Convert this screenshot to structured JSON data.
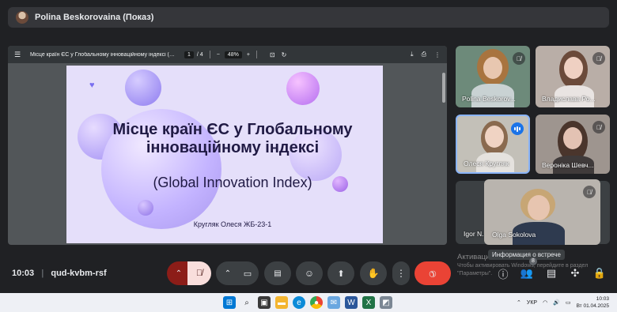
{
  "presenter": {
    "name": "Polina Beskorovaina (Показ)"
  },
  "pdf": {
    "title": "Місце країн ЄС у Глобальному інноваційному індексі (Global I...",
    "page_current": "1",
    "page_total": "/ 4",
    "zoom": "48%",
    "zoom_minus": "−",
    "zoom_plus": "+",
    "slide": {
      "title": "Місце країн ЄС у Глобальному інноваційному індексі",
      "subtitle": "(Global Innovation Index)",
      "author": "Кругляк Олеся ЖБ-23-1"
    }
  },
  "participants": [
    {
      "name": "Polina Beskorov...",
      "muted": true
    },
    {
      "name": "Владислава Ро...",
      "muted": true
    },
    {
      "name": "Олеся Кругляк",
      "speaking": true
    },
    {
      "name": "Вероніка Шевч...",
      "muted": true
    },
    {
      "name": "Igor N...",
      "muted": false
    },
    {
      "name": "Olga Sokolova",
      "muted": true
    }
  ],
  "meeting": {
    "time": "10:03",
    "separator": "|",
    "code": "qud-kvbm-rsf"
  },
  "tooltip": "Информация о встрече",
  "people_count": "8",
  "windows_activation": {
    "title": "Активация Windows",
    "text": "Чтобы активировать Windows, перейдите в раздел \"Параметры\"."
  },
  "taskbar": {
    "language": "УКР",
    "time": "10:03",
    "date": "Вт 01.04.2025"
  },
  "colors": {
    "accent": "#1a73e8",
    "end_call": "#ea4335",
    "slide_bg": "#e5dffa"
  }
}
